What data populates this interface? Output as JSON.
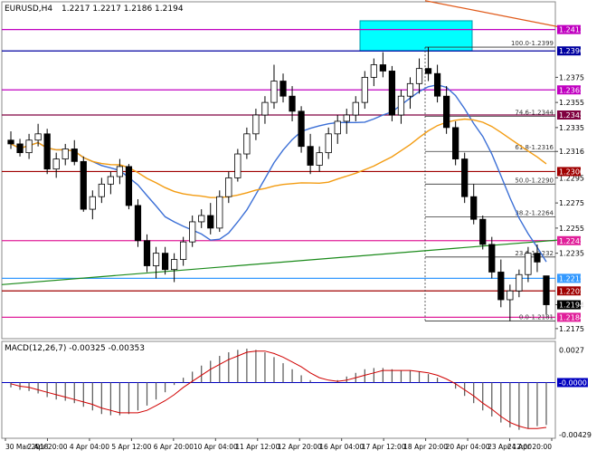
{
  "header": {
    "symbol": "EURUSD,H4",
    "ohlc": "1.2217 1.2217 1.2186 1.2194"
  },
  "macd_header": "MACD(12,26,7) -0.00325 -0.00353",
  "chart_data": [
    {
      "type": "candlestick",
      "ylim": [
        1.2167,
        1.2425
      ],
      "y_ticks": [
        "1.2375",
        "1.2355",
        "1.2335",
        "1.2316",
        "1.2295",
        "1.2275",
        "1.2255",
        "1.2235",
        "1.2194",
        "1.2175"
      ],
      "x_ticks": [
        "30 Mar 2018",
        "2 Apr 20:00",
        "4 Apr 04:00",
        "5 Apr 12:00",
        "6 Apr 20:00",
        "10 Apr 04:00",
        "11 Apr 12:00",
        "12 Apr 20:00",
        "16 Apr 04:00",
        "17 Apr 12:00",
        "18 Apr 20:00",
        "20 Apr 04:00",
        "23 Apr 12:00",
        "24 Apr 20:00"
      ],
      "current_price": "1.2194",
      "levels": [
        {
          "label": "1.2413",
          "value": 1.2413,
          "color": "#c000c0"
        },
        {
          "label": "1.2396",
          "value": 1.2396,
          "color": "#0000a0"
        },
        {
          "label": "1.2365",
          "value": 1.2365,
          "color": "#c000c0"
        },
        {
          "label": "1.2345",
          "value": 1.2345,
          "color": "#800040"
        },
        {
          "label": "1.2300",
          "value": 1.23,
          "color": "#a00000"
        },
        {
          "label": "1.2245",
          "value": 1.2245,
          "color": "#e0209a"
        },
        {
          "label": "1.2215",
          "value": 1.2215,
          "color": "#3399ff"
        },
        {
          "label": "1.2205",
          "value": 1.2205,
          "color": "#a00000"
        },
        {
          "label": "1.2184",
          "value": 1.2184,
          "color": "#e0209a"
        }
      ],
      "fibonacci": [
        {
          "label": "100.0-1.2399",
          "value": 1.2399
        },
        {
          "label": "74.6-1.2344",
          "value": 1.2344
        },
        {
          "label": "61.8-1.2316",
          "value": 1.2316
        },
        {
          "label": "50.0-1.2290",
          "value": 1.229
        },
        {
          "label": "38.2-1.2264",
          "value": 1.2264
        },
        {
          "label": "23.6-1.2232",
          "value": 1.2232
        },
        {
          "label": "0.0-1.2181",
          "value": 1.2181
        }
      ],
      "candles": [
        [
          1.2325,
          1.2332,
          1.2318,
          1.2322
        ],
        [
          1.2322,
          1.2326,
          1.2312,
          1.2315
        ],
        [
          1.2315,
          1.233,
          1.231,
          1.2325
        ],
        [
          1.2325,
          1.2338,
          1.232,
          1.233
        ],
        [
          1.233,
          1.2334,
          1.2298,
          1.2302
        ],
        [
          1.2302,
          1.2315,
          1.2295,
          1.231
        ],
        [
          1.231,
          1.2322,
          1.2305,
          1.2318
        ],
        [
          1.2318,
          1.2325,
          1.2305,
          1.2308
        ],
        [
          1.2308,
          1.2312,
          1.2268,
          1.227
        ],
        [
          1.227,
          1.2285,
          1.2262,
          1.228
        ],
        [
          1.228,
          1.2295,
          1.2275,
          1.229
        ],
        [
          1.229,
          1.23,
          1.2282,
          1.2296
        ],
        [
          1.2296,
          1.231,
          1.229,
          1.2304
        ],
        [
          1.2304,
          1.2306,
          1.227,
          1.2273
        ],
        [
          1.2273,
          1.2278,
          1.224,
          1.2245
        ],
        [
          1.2245,
          1.225,
          1.222,
          1.2225
        ],
        [
          1.2225,
          1.224,
          1.2215,
          1.2235
        ],
        [
          1.2235,
          1.224,
          1.2218,
          1.2222
        ],
        [
          1.2222,
          1.2235,
          1.2212,
          1.223
        ],
        [
          1.223,
          1.2248,
          1.2225,
          1.2244
        ],
        [
          1.2244,
          1.2265,
          1.224,
          1.226
        ],
        [
          1.226,
          1.227,
          1.2255,
          1.2265
        ],
        [
          1.2265,
          1.2275,
          1.225,
          1.2255
        ],
        [
          1.2255,
          1.2285,
          1.2252,
          1.228
        ],
        [
          1.228,
          1.23,
          1.2275,
          1.2295
        ],
        [
          1.2295,
          1.2318,
          1.2292,
          1.2314
        ],
        [
          1.2314,
          1.2335,
          1.231,
          1.233
        ],
        [
          1.233,
          1.235,
          1.2325,
          1.2345
        ],
        [
          1.2345,
          1.236,
          1.2338,
          1.2355
        ],
        [
          1.2355,
          1.2385,
          1.235,
          1.2372
        ],
        [
          1.2372,
          1.2378,
          1.2355,
          1.236
        ],
        [
          1.236,
          1.2368,
          1.234,
          1.2348
        ],
        [
          1.2348,
          1.2352,
          1.2315,
          1.232
        ],
        [
          1.232,
          1.233,
          1.2298,
          1.2305
        ],
        [
          1.2305,
          1.232,
          1.23,
          1.2315
        ],
        [
          1.2315,
          1.2335,
          1.231,
          1.233
        ],
        [
          1.233,
          1.2345,
          1.2322,
          1.234
        ],
        [
          1.234,
          1.235,
          1.233,
          1.2345
        ],
        [
          1.2345,
          1.236,
          1.234,
          1.2355
        ],
        [
          1.2355,
          1.238,
          1.235,
          1.2375
        ],
        [
          1.2375,
          1.239,
          1.2368,
          1.2385
        ],
        [
          1.2385,
          1.2395,
          1.2375,
          1.238
        ],
        [
          1.238,
          1.2384,
          1.234,
          1.2345
        ],
        [
          1.2345,
          1.2365,
          1.2338,
          1.236
        ],
        [
          1.236,
          1.2375,
          1.235,
          1.237
        ],
        [
          1.237,
          1.239,
          1.2362,
          1.2382
        ],
        [
          1.2382,
          1.2399,
          1.2372,
          1.2378
        ],
        [
          1.2378,
          1.2385,
          1.2355,
          1.236
        ],
        [
          1.236,
          1.2368,
          1.233,
          1.2335
        ],
        [
          1.2335,
          1.234,
          1.2305,
          1.231
        ],
        [
          1.231,
          1.2315,
          1.2275,
          1.228
        ],
        [
          1.228,
          1.229,
          1.2258,
          1.2262
        ],
        [
          1.2262,
          1.2265,
          1.2238,
          1.2242
        ],
        [
          1.2242,
          1.2248,
          1.2215,
          1.222
        ],
        [
          1.222,
          1.223,
          1.2192,
          1.2198
        ],
        [
          1.2198,
          1.221,
          1.2181,
          1.2205
        ],
        [
          1.2205,
          1.2222,
          1.22,
          1.2218
        ],
        [
          1.2218,
          1.224,
          1.2212,
          1.2235
        ],
        [
          1.2235,
          1.2242,
          1.222,
          1.2228
        ],
        [
          1.2217,
          1.2217,
          1.2186,
          1.2194
        ]
      ]
    },
    {
      "type": "histogram",
      "name": "MACD(12,26,7)",
      "y_ticks": [
        "0.0027",
        "-0.0000",
        "-0.00429"
      ],
      "ylim": [
        -0.0046,
        0.0034
      ],
      "macd": [
        -0.0004,
        -0.0006,
        -0.0007,
        -0.0009,
        -0.0012,
        -0.0014,
        -0.0015,
        -0.0017,
        -0.002,
        -0.0023,
        -0.0026,
        -0.0027,
        -0.0027,
        -0.0026,
        -0.0023,
        -0.0019,
        -0.0014,
        -0.0008,
        -0.0002,
        0.0004,
        0.0009,
        0.0014,
        0.0018,
        0.0022,
        0.0025,
        0.0027,
        0.0028,
        0.0027,
        0.0025,
        0.0021,
        0.0016,
        0.0011,
        0.0006,
        0.0002,
        0.0,
        0.0,
        0.0002,
        0.0005,
        0.0008,
        0.0011,
        0.0012,
        0.0012,
        0.0011,
        0.001,
        0.001,
        0.0009,
        0.0007,
        0.0004,
        0.0,
        -0.0005,
        -0.0011,
        -0.0017,
        -0.0023,
        -0.0028,
        -0.0033,
        -0.0037,
        -0.0039,
        -0.0038,
        -0.0036,
        -0.0035
      ],
      "signal": [
        -0.0001,
        -0.0003,
        -0.0004,
        -0.0006,
        -0.0008,
        -0.001,
        -0.0012,
        -0.0014,
        -0.0016,
        -0.0018,
        -0.0021,
        -0.0023,
        -0.0025,
        -0.0025,
        -0.0025,
        -0.0023,
        -0.0019,
        -0.0015,
        -0.001,
        -0.0004,
        0.0001,
        0.0006,
        0.0011,
        0.0015,
        0.0019,
        0.0022,
        0.0025,
        0.0026,
        0.0026,
        0.0024,
        0.0021,
        0.0017,
        0.0013,
        0.0008,
        0.0004,
        0.0002,
        0.0001,
        0.0002,
        0.0004,
        0.0006,
        0.0008,
        0.001,
        0.001,
        0.001,
        0.001,
        0.0009,
        0.0008,
        0.0006,
        0.0003,
        -0.0001,
        -0.0006,
        -0.0011,
        -0.0017,
        -0.0022,
        -0.0028,
        -0.0033,
        -0.0036,
        -0.0038,
        -0.0038,
        -0.0037
      ]
    }
  ],
  "colors": {
    "bull_body": "#ffffff",
    "bear_body": "#000000",
    "sma_fast": "#3b6fd6",
    "sma_slow": "#f39c12",
    "trendline_up": "#1a8a1a",
    "trendline_down": "#e05a1a",
    "zone": "#00ffff",
    "current_price_bg": "#000000",
    "level_text": "#ffffff"
  }
}
